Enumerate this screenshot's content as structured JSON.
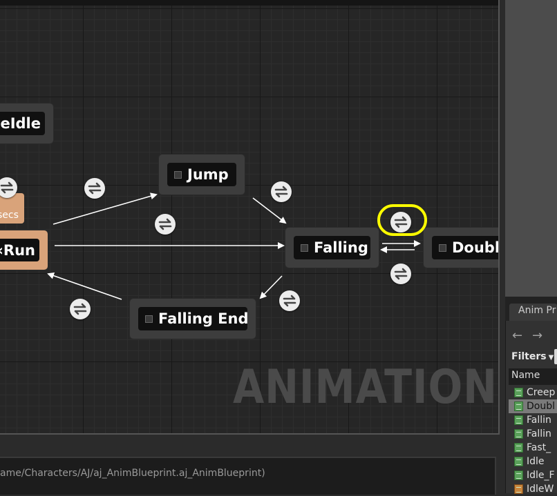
{
  "graph": {
    "watermark": "ANIMATION",
    "nodes": {
      "idle": "eIdle",
      "run": "‹Run",
      "jump": "Jump",
      "falling": "Falling",
      "double": "Double",
      "falling_end": "Falling End"
    },
    "tag_text": "secs",
    "transition_icon": "transition-rule-icon",
    "highlight_color": "#ffff00",
    "active_node_color": "#d9a37a"
  },
  "asset_panel": {
    "tab_label": "Anim Pr",
    "filters_label": "Filters",
    "name_header": "Name",
    "items": [
      {
        "label": "Creep"
      },
      {
        "label": "Doubl"
      },
      {
        "label": "Fallin"
      },
      {
        "label": "Fallin"
      },
      {
        "label": "Fast_"
      },
      {
        "label": "Idle"
      },
      {
        "label": "Idle_F"
      },
      {
        "label": "IdleW"
      }
    ]
  },
  "status": {
    "path": "ame/Characters/AJ/aj_AnimBlueprint.aj_AnimBlueprint)"
  }
}
